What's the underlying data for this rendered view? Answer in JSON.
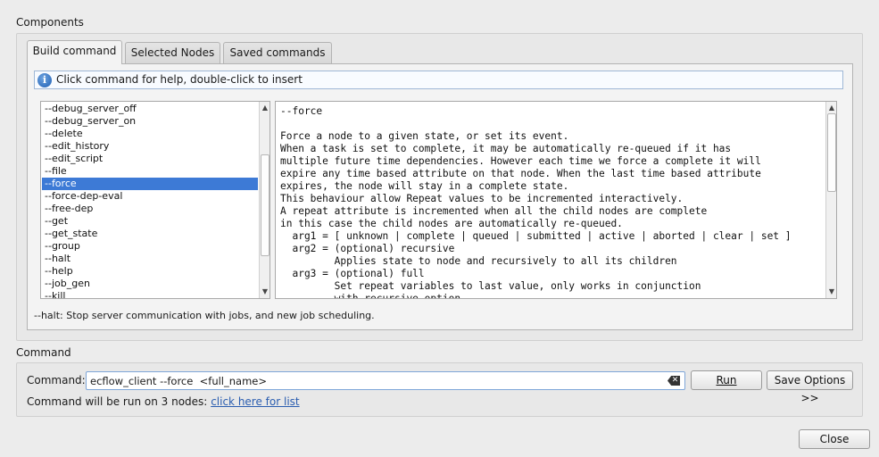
{
  "components": {
    "title": "Components",
    "tabs": [
      {
        "label": "Build command",
        "active": true
      },
      {
        "label": "Selected Nodes",
        "active": false
      },
      {
        "label": "Saved commands",
        "active": false
      }
    ],
    "info": {
      "icon": "info-icon",
      "text": "Click command for help, double-click to insert"
    },
    "commands": [
      "--debug_server_off",
      "--debug_server_on",
      "--delete",
      "--edit_history",
      "--edit_script",
      "--file",
      "--force",
      "--force-dep-eval",
      "--free-dep",
      "--get",
      "--get_state",
      "--group",
      "--halt",
      "--help",
      "--job_gen",
      "--kill"
    ],
    "selected_command": "--force",
    "help_text": "--force\n\nForce a node to a given state, or set its event.\nWhen a task is set to complete, it may be automatically re-queued if it has\nmultiple future time dependencies. However each time we force a complete it will\nexpire any time based attribute on that node. When the last time based attribute\nexpires, the node will stay in a complete state.\nThis behaviour allow Repeat values to be incremented interactively.\nA repeat attribute is incremented when all the child nodes are complete\nin this case the child nodes are automatically re-queued.\n  arg1 = [ unknown | complete | queued | submitted | active | aborted | clear | set ]\n  arg2 = (optional) recursive\n         Applies state to node and recursively to all its children\n  arg3 = (optional) full\n         Set repeat variables to last value, only works in conjunction\n         with recursive option",
    "status": "--halt: Stop server communication with jobs, and new job scheduling."
  },
  "command": {
    "title": "Command",
    "label": "Command:",
    "value": "ecflow_client --force  <full_name>",
    "run_label": "Run",
    "save_options_label": "Save Options >>",
    "hint_text": "Command will be run on 3 nodes:",
    "hint_link": "click here for list"
  },
  "close_label": "Close",
  "colors": {
    "selection": "#3d7ad6",
    "link": "#2a5db0",
    "info_border": "#9fb8d6"
  }
}
